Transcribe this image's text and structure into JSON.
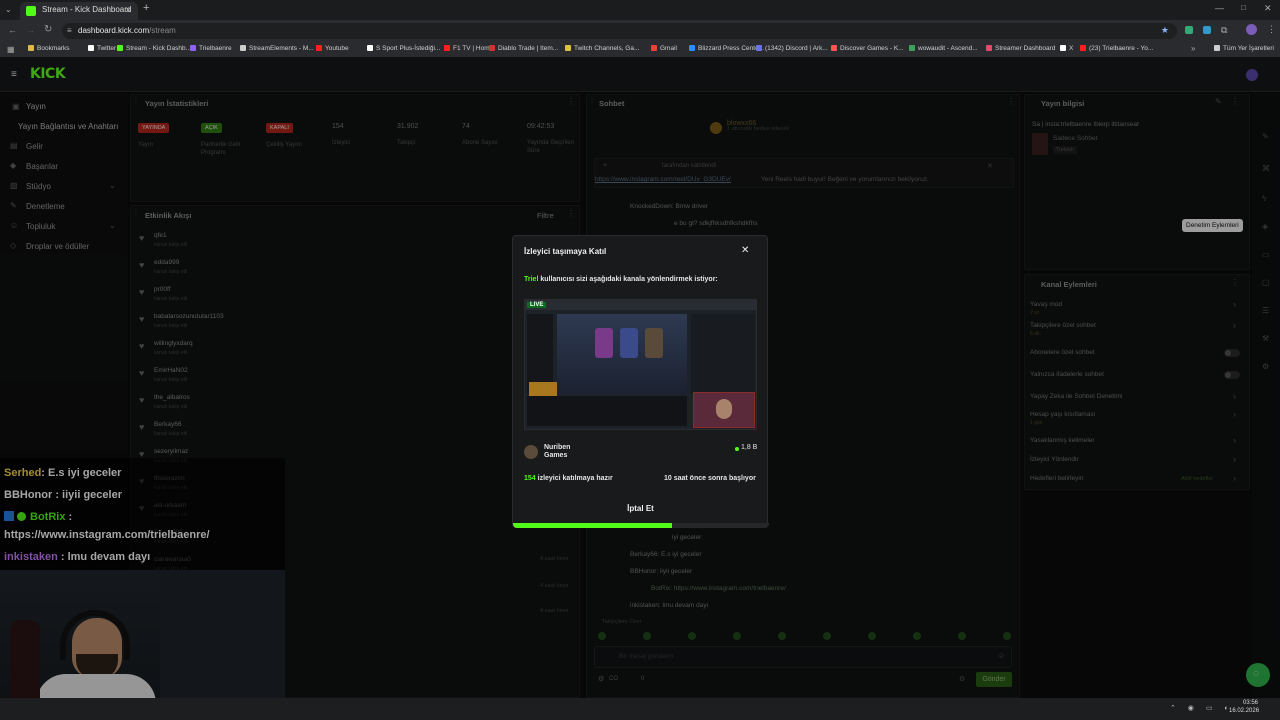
{
  "browser": {
    "tab_title": "Stream - Kick Dashboard",
    "url_host": "dashboard.kick.com",
    "url_path": "/stream",
    "bookmarks": [
      {
        "label": "Bookmarks",
        "color": "#e0b84a"
      },
      {
        "label": "Twitter",
        "color": "#ffffff"
      },
      {
        "label": "Stream - Kick Dashb...",
        "color": "#53fc18"
      },
      {
        "label": "Trielbaenre",
        "color": "#8f62ff"
      },
      {
        "label": "StreamElements - M...",
        "color": "#cccccc"
      },
      {
        "label": "Youtube",
        "color": "#ff2020"
      },
      {
        "label": "S Sport Plus-İstediği...",
        "color": "#ffffff"
      },
      {
        "label": "F1 TV | Home",
        "color": "#ff2020"
      },
      {
        "label": "Diablo Trade | Item...",
        "color": "#cc3333"
      },
      {
        "label": "Twitch Channels, Ga...",
        "color": "#e0c040"
      },
      {
        "label": "Gmail",
        "color": "#ea4335"
      },
      {
        "label": "Blizzard Press Cente...",
        "color": "#2a8cff"
      },
      {
        "label": "(1342) Discord | Ark...",
        "color": "#6a74e8"
      },
      {
        "label": "Discover Games - K...",
        "color": "#ff5555"
      },
      {
        "label": "wowaudit - Ascend...",
        "color": "#3aa55a"
      },
      {
        "label": "Streamer Dashboard",
        "color": "#e64a6a"
      },
      {
        "label": "X",
        "color": "#ffffff"
      },
      {
        "label": "(23) Trielbaenre - Yo...",
        "color": "#ff2020"
      },
      {
        "label": "Tüm Yer İşaretleri",
        "color": "#cccccc"
      }
    ]
  },
  "sidebar": {
    "items": [
      {
        "label": "Yayın"
      },
      {
        "label": "Yayın Bağlantısı ve Anahtarı"
      },
      {
        "label": "Gelir"
      },
      {
        "label": "Başarılar"
      },
      {
        "label": "Stüdyo"
      },
      {
        "label": "Denetleme"
      },
      {
        "label": "Topluluk"
      },
      {
        "label": "Droplar ve ödüller"
      }
    ]
  },
  "stats": {
    "title": "Yayın İstatistikleri",
    "badges": [
      "YAYINDA",
      "AÇIK",
      "KAPALI"
    ],
    "badge_colors": [
      "#b3261e",
      "#2f7a12",
      "#b3261e"
    ],
    "labels": [
      "Yayın",
      "Partnerlik Gelir Programı",
      "Çekiliş Yayını",
      "İzleyici",
      "Takipçi",
      "Abone Sayısı",
      "Yayında Geçirilen Süre"
    ],
    "values": [
      "154",
      "31.902",
      "74",
      "09:42:53"
    ]
  },
  "events": {
    "title": "Etkinlik Akışı",
    "filter": "Filtre",
    "sub": "kanalı takip etti",
    "names": [
      "qfe1",
      "edda999",
      "pr00ff",
      "babalarsozunututar1103",
      "willinglyxdarq",
      "EmirHaN02",
      "the_albatros",
      "Berkay66",
      "sezeryilmaz",
      "thisisrazim",
      "asl-urkaam",
      "Spyce999",
      "ciarawanaa0"
    ],
    "times": [
      "4 saat önce",
      "4 saat önce",
      "4 saat önce"
    ]
  },
  "chat": {
    "title": "Sohbet",
    "top_user": "blowxx66",
    "top_sub": "1 abonelik hediye edecek",
    "pinned_by": "tarafından sabitlendi",
    "pinned_url": "https://www.instagram.com/reel/DUx_G3DUEv/",
    "pinned_rest": "Yeni Reels hadi buyur! Beğeni ve yorumlarınızı bekliyoruz.",
    "lines": [
      "KnockedDown: Bmw driver",
      "e bu gt?  sdkjfhksdhfkshdkfhs",
      "Berkay66: E.s iyi geceler",
      "BBHonor: iiyii geceler",
      "BotRix: https://www.instagram.com/trielbaenre/",
      "inkistaken: lmu devam dayı"
    ],
    "line_top": "iyi geceler",
    "input_placeholder": "Bir mesaj gönderin",
    "send": "Gönder",
    "bottom_counts": [
      "CO",
      "0"
    ],
    "follower_label": "Takipçilere Özel"
  },
  "stream_info": {
    "title": "Yayın bilgisi",
    "stream_title": "Sa | insta:trielbaenre Ibierp iltitanseat",
    "sub": "Sadece Sohbet",
    "lang": "Turkish",
    "tooltip": "Denetim Eylemleri"
  },
  "channel_actions": {
    "title": "Kanal Eylemleri",
    "items": [
      {
        "label": "Yavaş mod",
        "sub": "2 sn."
      },
      {
        "label": "Takipçilere özel sohbet",
        "sub": "6 dk."
      },
      {
        "label": "Abonelere özel sohbet",
        "sub": ""
      },
      {
        "label": "Yalnızca ifadelerle sohbet",
        "sub": ""
      },
      {
        "label": "Yapay Zeka ile Sohbet Denetimi",
        "sub": ""
      },
      {
        "label": "Hesap yaşı kısıtlaması",
        "sub": "1 gün"
      },
      {
        "label": "Yasaklanmış kelimeler",
        "sub": ""
      },
      {
        "label": "İzleyici Yönlendir",
        "sub": ""
      },
      {
        "label": "Hedefleri belirleyin",
        "sub": ""
      }
    ],
    "goal_status": "Aktif hedefler"
  },
  "overlay_chat": [
    {
      "user": "Serhed",
      "color": "#ffd84a",
      "text": ": E.s iyi geceler"
    },
    {
      "user": "BBHonor",
      "color": "#ffffff",
      "text": " : iiyii geceler"
    },
    {
      "user": "BotRix",
      "color": "#53fc18",
      "text": " :"
    },
    {
      "user": "",
      "color": "#ffffff",
      "text": "https://www.instagram.com/trielbaenre/"
    },
    {
      "user": "inkistaken",
      "color": "#c77dff",
      "text": " : lmu devam dayı"
    }
  ],
  "modal": {
    "title": "İzleyici taşımaya Katıl",
    "requester": "Triel",
    "desc": " kullanıcısı sizi aşağıdaki kanala yönlendirmek istiyor:",
    "live_badge": "LIVE",
    "channel_line1": "Nuriben",
    "channel_line2": "Games",
    "viewer_count": "1,8 B",
    "ready_count": "154",
    "ready_text": " izleyici katılmaya hazır",
    "starts_in": "10 saat önce sonra başlıyor",
    "cancel": "İptal Et",
    "progress": 0.62
  },
  "taskbar": {
    "time": "03:56",
    "date": "16.02.2026"
  }
}
